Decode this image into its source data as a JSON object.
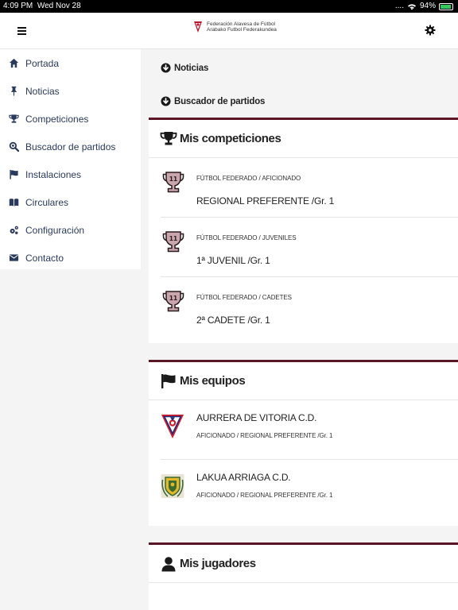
{
  "status": {
    "time": "4:09 PM",
    "date": "Wed Nov 28",
    "carrier": "....",
    "battery": "94%"
  },
  "header": {
    "logo_line1": "Federación Alavesa de Fútbol",
    "logo_line2": "Arabako Futbol Federakundea"
  },
  "sidebar": {
    "items": [
      {
        "label": "Portada",
        "icon": "home-icon"
      },
      {
        "label": "Noticias",
        "icon": "pin-icon"
      },
      {
        "label": "Competiciones",
        "icon": "trophy-icon"
      },
      {
        "label": "Buscador de partidos",
        "icon": "search-icon"
      },
      {
        "label": "Instalaciones",
        "icon": "flag-icon"
      },
      {
        "label": "Circulares",
        "icon": "book-icon"
      },
      {
        "label": "Configuración",
        "icon": "gears-icon"
      },
      {
        "label": "Contacto",
        "icon": "envelope-icon"
      }
    ]
  },
  "main": {
    "links": [
      {
        "label": "Noticias",
        "icon": "arrow-down-circle-icon"
      },
      {
        "label": "Buscador de partidos",
        "icon": "arrow-down-circle-icon"
      }
    ],
    "competitions": {
      "title": "Mis competiciones",
      "badge_number": "11",
      "items": [
        {
          "category": "FÚTBOL FEDERADO / AFICIONADO",
          "name": "REGIONAL PREFERENTE /Gr. 1"
        },
        {
          "category": "FÚTBOL FEDERADO / JUVENILES",
          "name": "1ª JUVENIL /Gr. 1"
        },
        {
          "category": "FÚTBOL FEDERADO / CADETES",
          "name": "2ª CADETE /Gr. 1"
        }
      ]
    },
    "teams": {
      "title": "Mis equipos",
      "items": [
        {
          "name": "AURRERA DE VITORIA C.D.",
          "category": "AFICIONADO / REGIONAL PREFERENTE /Gr. 1"
        },
        {
          "name": "LAKUA ARRIAGA C.D.",
          "category": "AFICIONADO / REGIONAL PREFERENTE /Gr. 1"
        }
      ]
    },
    "players": {
      "title": "Mis jugadores"
    }
  },
  "colors": {
    "accent": "#5a1627",
    "nav_text": "#2a3a5c",
    "trophy": "#c9a6ae"
  }
}
